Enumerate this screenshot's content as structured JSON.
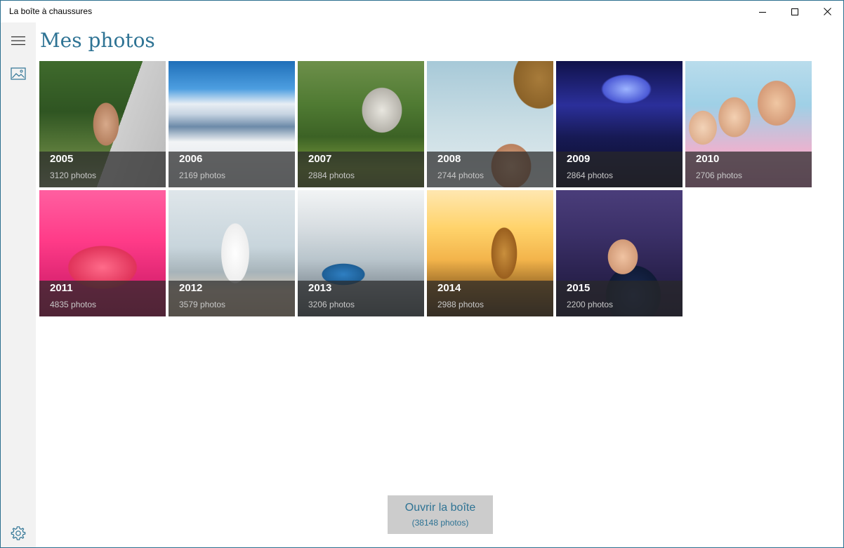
{
  "window": {
    "title": "La boîte à chaussures"
  },
  "icons": {
    "minimize": "minimize-icon",
    "maximize": "maximize-icon",
    "close": "close-icon",
    "menu": "hamburger-icon",
    "photos": "image-icon",
    "settings": "gear-icon"
  },
  "main": {
    "title": "Mes photos",
    "accent_color": "#2e7394",
    "tiles": [
      {
        "year": "2005",
        "count": "3120 photos"
      },
      {
        "year": "2006",
        "count": "2169 photos"
      },
      {
        "year": "2007",
        "count": "2884 photos"
      },
      {
        "year": "2008",
        "count": "2744 photos"
      },
      {
        "year": "2009",
        "count": "2864 photos"
      },
      {
        "year": "2010",
        "count": "2706 photos"
      },
      {
        "year": "2011",
        "count": "4835 photos"
      },
      {
        "year": "2012",
        "count": "3579 photos"
      },
      {
        "year": "2013",
        "count": "3206 photos"
      },
      {
        "year": "2014",
        "count": "2988 photos"
      },
      {
        "year": "2015",
        "count": "2200 photos"
      }
    ]
  },
  "footer": {
    "open_label": "Ouvrir la boîte",
    "open_count": "(38148 photos)"
  }
}
